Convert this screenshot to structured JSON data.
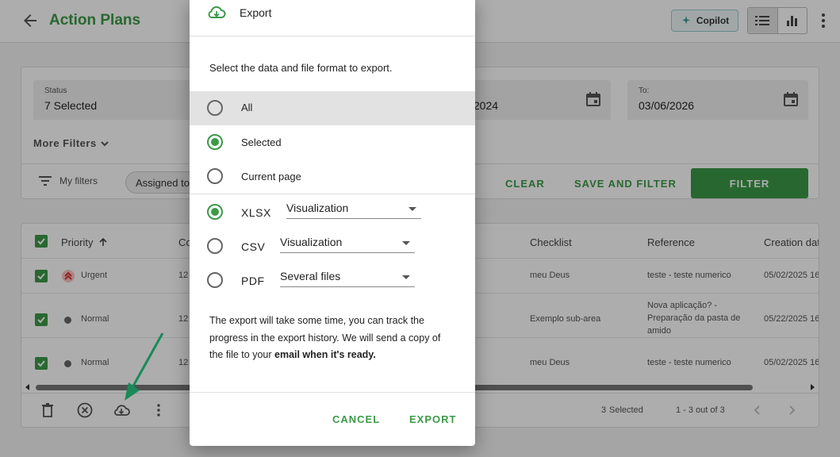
{
  "header": {
    "title": "Action Plans",
    "copilot_label": "Copilot"
  },
  "filters": {
    "status_label": "Status",
    "status_value": "7 Selected",
    "from_value_partial": "/2024",
    "to_label": "To:",
    "to_value": "03/06/2026",
    "more_filters": "More Filters",
    "my_filters": "My filters",
    "chip_label": "Assigned to",
    "clear": "CLEAR",
    "save_and_filter": "SAVE AND FILTER",
    "filter": "FILTER"
  },
  "table": {
    "headers": {
      "priority": "Priority",
      "code_partial": "Co",
      "checklist": "Checklist",
      "reference": "Reference",
      "creation_date": "Creation date"
    },
    "rows": [
      {
        "priority": "Urgent",
        "code": "12",
        "checklist": "meu Deus",
        "reference": "teste - teste numerico",
        "creation_date": "05/02/2025 16"
      },
      {
        "priority": "Normal",
        "code": "12",
        "checklist": "Exemplo sub-area",
        "reference": "Nova aplicação? - Preparação da pasta de amido",
        "creation_date": "05/22/2025 16"
      },
      {
        "priority": "Normal",
        "code": "12",
        "checklist": "meu Deus",
        "reference": "teste - teste numerico",
        "creation_date": "05/02/2025 16"
      }
    ],
    "footer": {
      "selected_count": "3",
      "selected_label": "Selected",
      "pagination": "1 - 3 out of 3"
    }
  },
  "dialog": {
    "title": "Export",
    "description": "Select the data and file format to export.",
    "scope_options": [
      {
        "label": "All",
        "selected": false
      },
      {
        "label": "Selected",
        "selected": true
      },
      {
        "label": "Current page",
        "selected": false
      }
    ],
    "formats": [
      {
        "label": "XLSX",
        "selected": true,
        "option": "Visualization"
      },
      {
        "label": "CSV",
        "selected": false,
        "option": "Visualization"
      },
      {
        "label": "PDF",
        "selected": false,
        "option": "Several files"
      }
    ],
    "notice_text": "The export will take some time, you can track the progress in the export history. We will send a copy of the file to your ",
    "notice_bold": "email when it's ready.",
    "cancel": "CANCEL",
    "export": "EXPORT"
  },
  "colors": {
    "brand_green": "#3c9a48",
    "annotation_arrow": "#1a8a5a",
    "overlay": "rgba(0,0,0,0.32)"
  }
}
